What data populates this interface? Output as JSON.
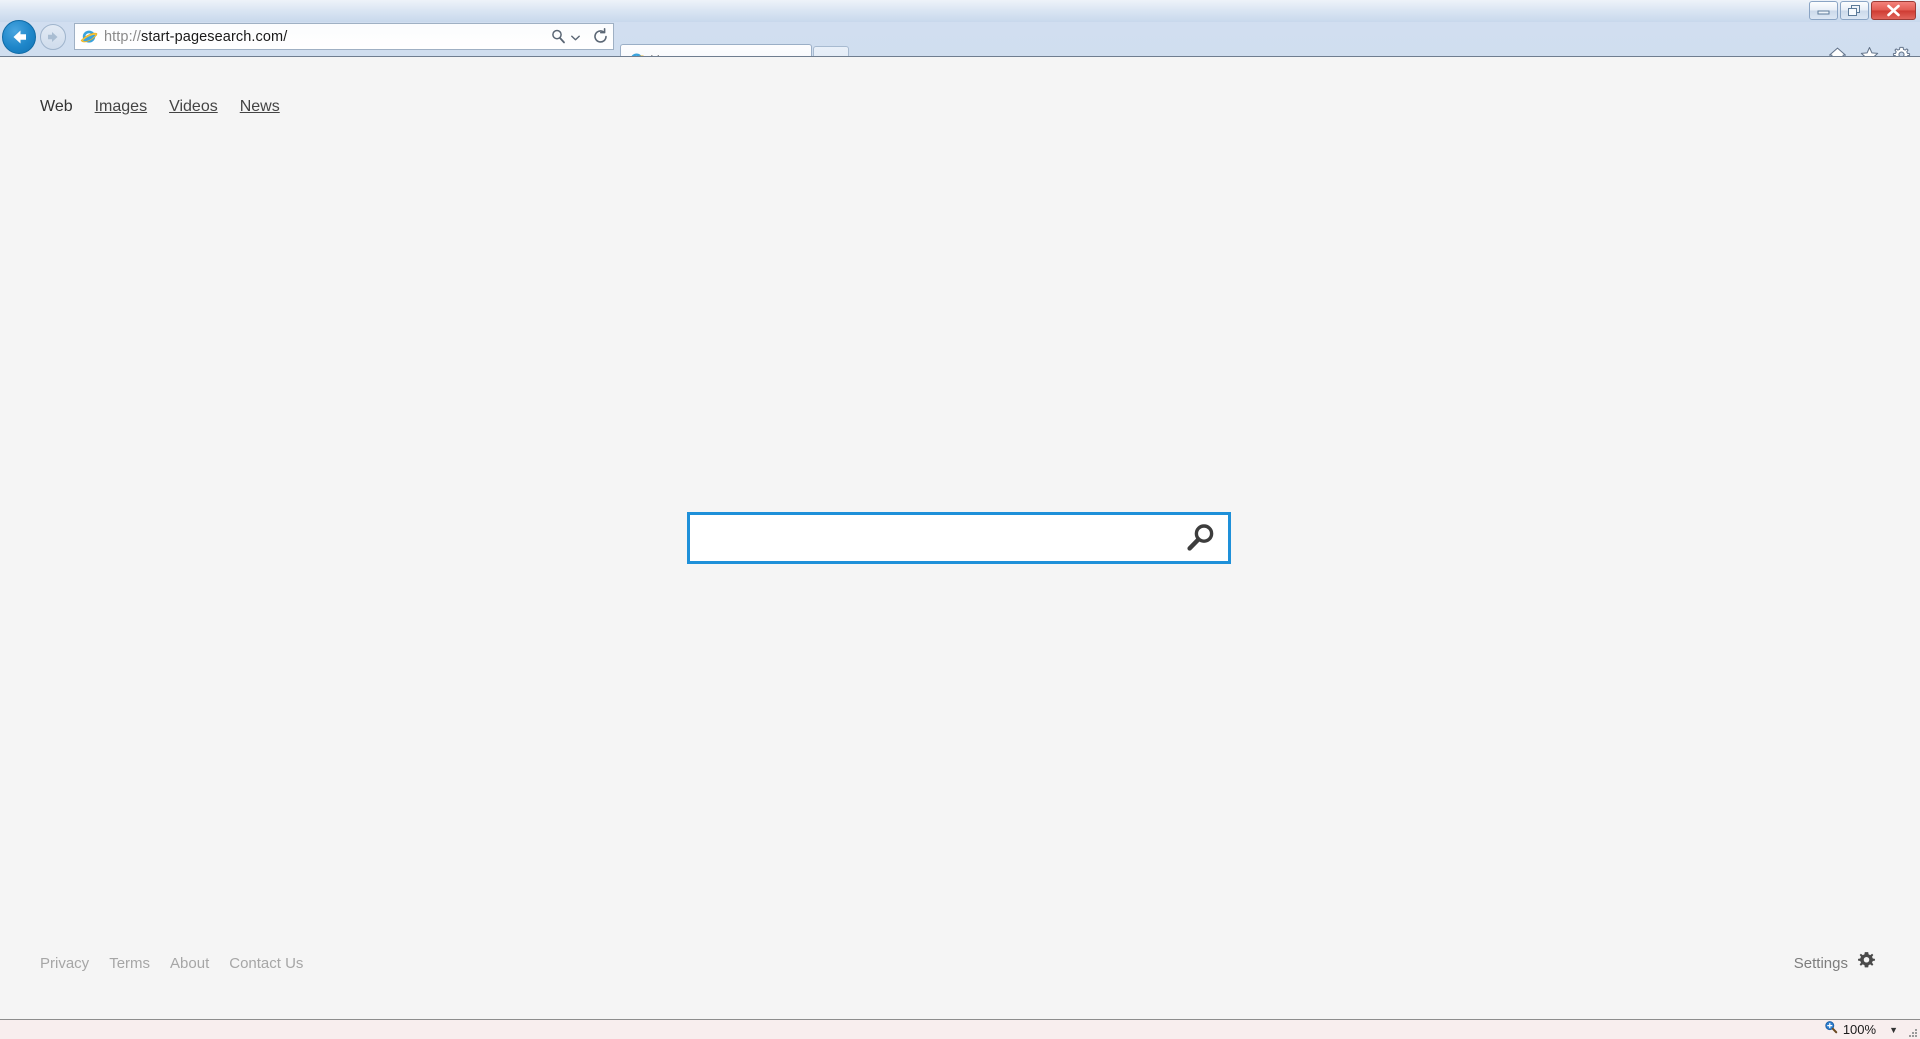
{
  "window": {
    "controls": [
      {
        "name": "minimize",
        "glyph": "minimize-icon"
      },
      {
        "name": "restore",
        "glyph": "restore-icon"
      },
      {
        "name": "close",
        "glyph": "close-icon"
      }
    ]
  },
  "browser": {
    "back_label": "Back",
    "forward_label": "Forward",
    "address": {
      "scheme": "http://",
      "host_path": "start-pagesearch.com/",
      "placeholder": "",
      "site_icon": "internet-explorer-icon",
      "search_icon": "search-icon",
      "refresh_icon": "refresh-icon"
    },
    "tabs": [
      {
        "title": "Homepage",
        "icon": "internet-explorer-icon",
        "close_glyph": "×",
        "active": true
      }
    ],
    "new_tab_label": "",
    "tools": [
      {
        "name": "home-icon",
        "label": "Home"
      },
      {
        "name": "favorites-icon",
        "label": "Favorites"
      },
      {
        "name": "tools-gear-icon",
        "label": "Tools"
      }
    ]
  },
  "page": {
    "nav": [
      {
        "label": "Web",
        "active": true
      },
      {
        "label": "Images",
        "active": false
      },
      {
        "label": "Videos",
        "active": false
      },
      {
        "label": "News",
        "active": false
      }
    ],
    "search": {
      "value": "",
      "placeholder": "",
      "button_icon": "search-magnifier-icon",
      "border_color": "#1e90d9"
    },
    "footer": {
      "links": [
        "Privacy",
        "Terms",
        "About",
        "Contact Us"
      ],
      "settings_label": "Settings",
      "settings_icon": "gear-icon"
    },
    "background_color": "#f5f5f5"
  },
  "status_bar": {
    "zoom_icon": "zoom-in-icon",
    "zoom_level": "100%",
    "caret": "▼",
    "background_color": "#f8eeee"
  }
}
